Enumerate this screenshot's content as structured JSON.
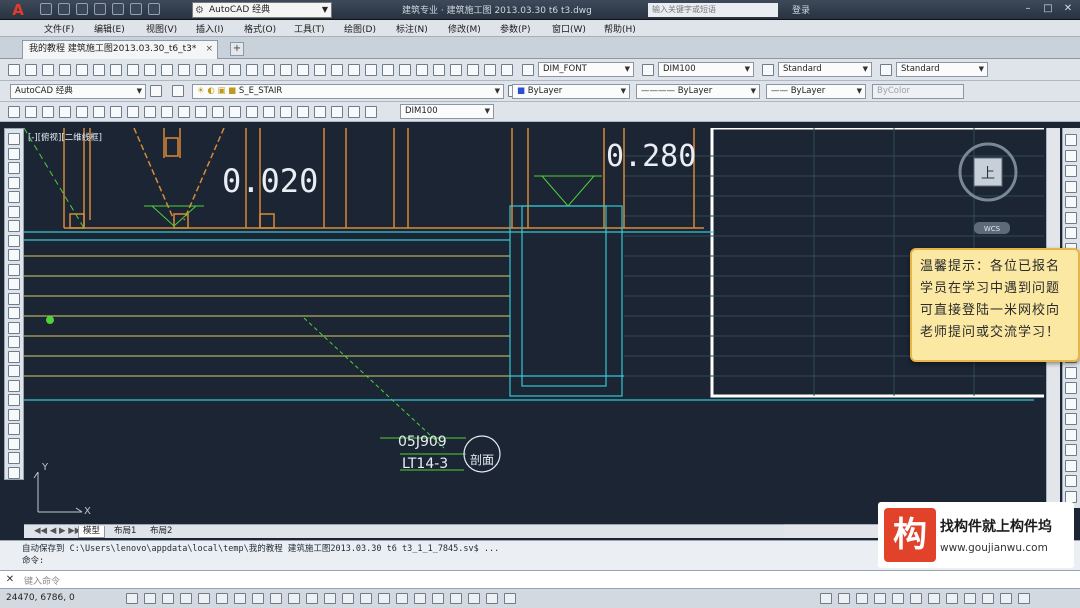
{
  "title_bar": {
    "workspace": "AutoCAD 经典",
    "doc_title": "建筑专业 · 建筑施工图 2013.03.30 t6 t3.dwg",
    "search_placeholder": "输入关键字或短语",
    "login": "登录"
  },
  "menu": [
    "文件(F)",
    "编辑(E)",
    "视图(V)",
    "插入(I)",
    "格式(O)",
    "工具(T)",
    "绘图(D)",
    "标注(N)",
    "修改(M)",
    "参数(P)",
    "窗口(W)",
    "帮助(H)"
  ],
  "document_tab": {
    "label": "我的教程 建筑施工图2013.03.30_t6_t3*",
    "close": "×"
  },
  "toolbar2": {
    "text_style": "DIM_FONT",
    "dim_style": "DIM100",
    "table_style": "Standard",
    "multileader_style": "Standard"
  },
  "toolbar3": {
    "workspace": "AutoCAD 经典",
    "layer": "S_E_STAIR",
    "color": "ByLayer",
    "linetype": "ByLayer",
    "lineweight": "ByLayer",
    "plotstyle": "ByColor"
  },
  "toolbar4": {
    "dim_style": "DIM100"
  },
  "canvas": {
    "viewport_label": "[-][俯视][二维线框]",
    "elev_left": "0.020",
    "elev_right": "0.280",
    "ref_top": "05J909",
    "ref_bottom": "LT14-3",
    "ref_circle": "剖面"
  },
  "viewcube": {
    "face": "上",
    "wcs": "WCS"
  },
  "notice": {
    "text": "温馨提示：各位已报名学员在学习中遇到问题可直接登陆一米网校向老师提问或交流学习！"
  },
  "layout_tabs": [
    "模型",
    "布局1",
    "布局2"
  ],
  "command": {
    "history_1": "自动保存到 C:\\Users\\lenovo\\appdata\\local\\temp\\我的教程 建筑施工图2013.03.30 t6 t3_1_1_7845.sv$ ...",
    "history_2": "命令:",
    "input_placeholder": "键入命令"
  },
  "status": {
    "coords": "24470, 6786, 0"
  },
  "watermark": {
    "logo": "构",
    "title": "找构件就上构件坞",
    "url": "www.goujianwu.com"
  },
  "colors": {
    "canvas": "#1b2533",
    "orange": "#d98a38",
    "cyan": "#34c7d3",
    "green": "#4fd13a",
    "yellow": "#d4d06a"
  }
}
